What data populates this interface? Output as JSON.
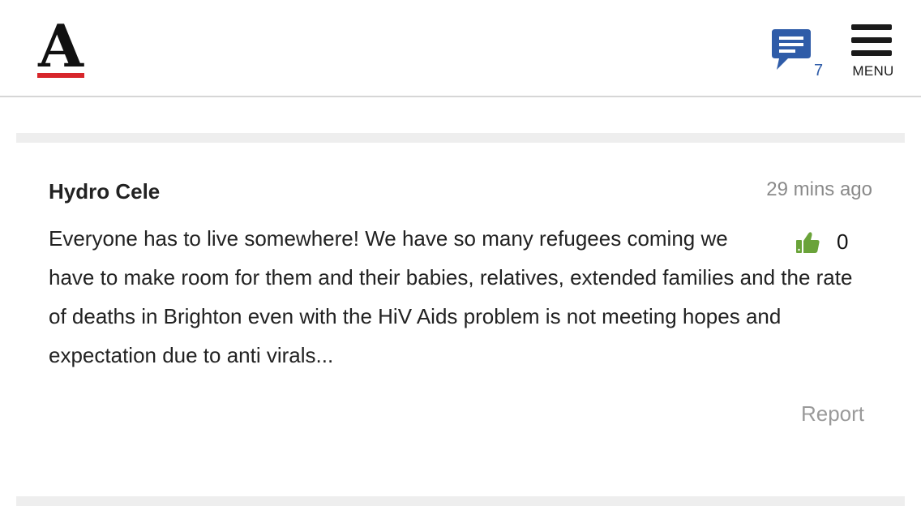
{
  "header": {
    "logo_letter": "A",
    "comments_count": "7",
    "menu_label": "MENU",
    "colors": {
      "logo_bar": "#d7262b",
      "comments_icon": "#2f5ca8"
    },
    "icons": [
      "chat-bubble-icon",
      "hamburger-menu-icon"
    ]
  },
  "comment": {
    "author": "Hydro Cele",
    "time": "29 mins ago",
    "text": "Everyone has to live somewhere! We have so many refugees coming we have to make room for them and their babies, relatives, extended families and the rate of deaths in Brighton even with the HiV Aids problem is not meeting hopes and expectation due to anti virals...",
    "likes": "0",
    "like_icon": "thumbs-up-icon",
    "like_color": "#6aa339",
    "report_label": "Report"
  }
}
